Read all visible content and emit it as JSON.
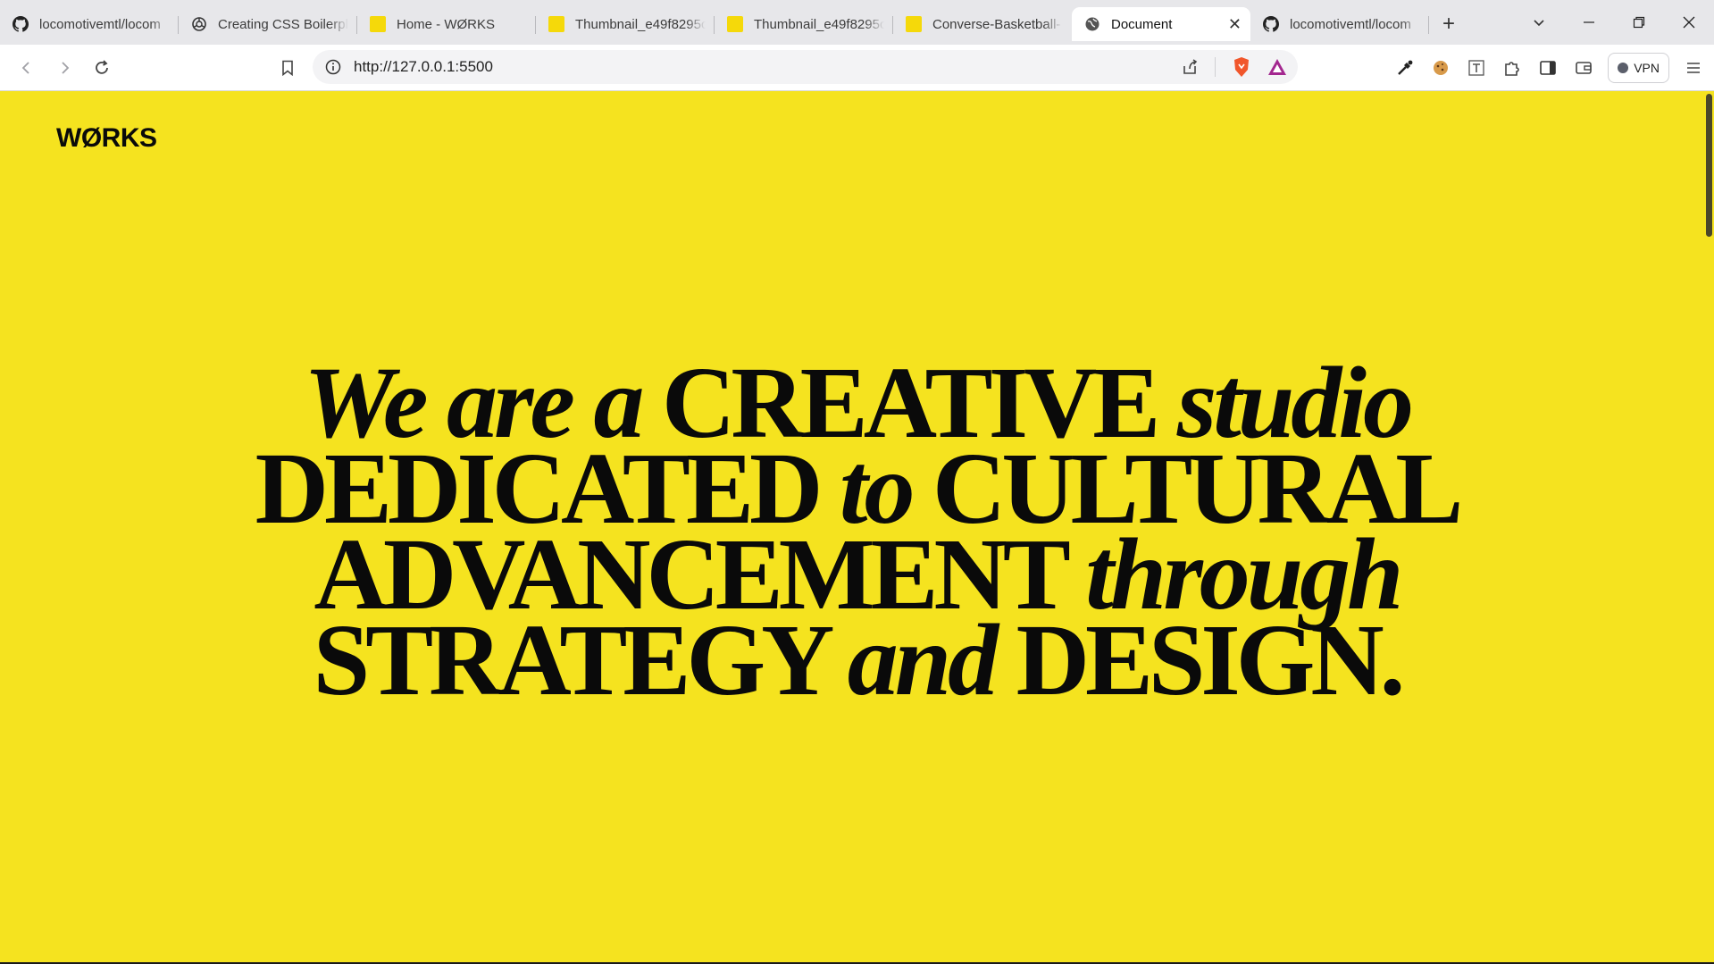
{
  "tabs": [
    {
      "title": "locomotivemtl/locom",
      "icon": "github-icon",
      "active": false
    },
    {
      "title": "Creating CSS Boilerpl",
      "icon": "openai-icon",
      "active": false
    },
    {
      "title": "Home - WØRKS",
      "icon": "yellow-square-icon",
      "active": false
    },
    {
      "title": "Thumbnail_e49f8295c",
      "icon": "yellow-square-icon",
      "active": false
    },
    {
      "title": "Thumbnail_e49f8295c",
      "icon": "yellow-square-icon",
      "active": false
    },
    {
      "title": "Converse-Basketball-",
      "icon": "yellow-square-icon",
      "active": false
    },
    {
      "title": "Document",
      "icon": "globe-icon",
      "active": true
    },
    {
      "title": "locomotivemtl/locom",
      "icon": "github-icon",
      "active": false
    }
  ],
  "address_bar": {
    "url": "http://127.0.0.1:5500"
  },
  "vpn_label": "VPN",
  "page": {
    "logo": "WØRKS",
    "hero": {
      "line1": {
        "a": "We are a",
        "b": "CREATIVE",
        "c": "studio"
      },
      "line2": {
        "a": "DEDICATED",
        "b": "to",
        "c": "CULTURAL"
      },
      "line3": {
        "a": "ADVANCEMENT",
        "b": "through"
      },
      "line4": {
        "a": "STRATEGY",
        "b": "and",
        "c": "DESIGN."
      }
    },
    "background_color": "#f5e31f",
    "text_color": "#0a0a0a"
  }
}
